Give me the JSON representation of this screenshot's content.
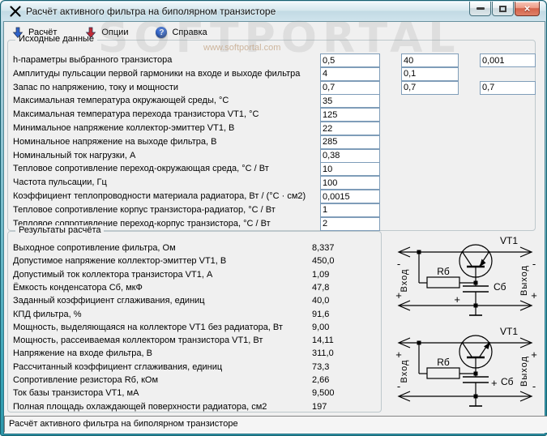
{
  "window": {
    "title": "Расчёт активного фильтра на биполярном транзисторе"
  },
  "toolbar": {
    "items": [
      {
        "label": "Расчёт",
        "icon": "calc-arrow-down-icon",
        "icon_color": "#2f62c9"
      },
      {
        "label": "Опции",
        "icon": "options-arrow-down-icon",
        "icon_color": "#c22a35"
      },
      {
        "label": "Справка",
        "icon": "help-icon",
        "icon_color": "#3b6fd6"
      }
    ]
  },
  "watermark": {
    "big_text": "SOFTPORTAL",
    "url_text": "www.softportal.com"
  },
  "inputs": {
    "legend": "Исходные данные",
    "rows": [
      {
        "label": "h-параметры выбранного транзистора",
        "values": [
          "0,5",
          "40",
          "0,001"
        ]
      },
      {
        "label": "Амплитуды пульсации первой гармоники на входе и выходе фильтра",
        "values": [
          "4",
          "0,1"
        ]
      },
      {
        "label": "Запас по напряжению, току и мощности",
        "values": [
          "0,7",
          "0,7",
          "0,7"
        ]
      },
      {
        "label": "Максимальная температура окружающей среды, °С",
        "values": [
          "35"
        ]
      },
      {
        "label": "Максимальная температура перехода транзистора VT1, °С",
        "values": [
          "125"
        ]
      },
      {
        "label": "Минимальное напряжение коллектор-эмиттер VT1, В",
        "values": [
          "22"
        ]
      },
      {
        "label": "Номинальное напряжение на выходе фильтра, В",
        "values": [
          "285"
        ]
      },
      {
        "label": "Номинальный ток нагрузки, А",
        "values": [
          "0,38"
        ]
      },
      {
        "label": "Тепловое сопротивление переход-окружающая среда, °С / Вт",
        "values": [
          "10"
        ]
      },
      {
        "label": "Частота пульсации, Гц",
        "values": [
          "100"
        ]
      },
      {
        "label": "Коэффициент теплопроводности материала радиатора, Вт / (°С · см2)",
        "values": [
          "0,0015"
        ]
      },
      {
        "label": "Тепловое сопротивление корпус транзистора-радиатор, °С / Вт",
        "values": [
          "1"
        ]
      },
      {
        "label": "Тепловое сопротивление переход-корпус транзистора, °С / Вт",
        "values": [
          "2"
        ]
      }
    ]
  },
  "results": {
    "legend": "Результаты расчёта",
    "rows": [
      {
        "label": "Выходное сопротивление фильтра, Ом",
        "value": "8,337"
      },
      {
        "label": "Допустимое напряжение коллектор-эмиттер VT1, В",
        "value": "450,0"
      },
      {
        "label": "Допустимый ток коллектора транзистора VT1, А",
        "value": "1,09"
      },
      {
        "label": "Ёмкость конденсатора Сб, мкФ",
        "value": "47,8"
      },
      {
        "label": "Заданный коэффициент сглаживания, единиц",
        "value": "40,0"
      },
      {
        "label": "КПД фильтра, %",
        "value": "91,6"
      },
      {
        "label": "Мощность, выделяющаяся на коллекторе VT1 без радиатора, Вт",
        "value": "9,00"
      },
      {
        "label": "Мощность, рассеиваемая коллектором транзистора VT1, Вт",
        "value": "14,11"
      },
      {
        "label": "Напряжение на входе фильтра, В",
        "value": "311,0"
      },
      {
        "label": "Рассчитанный коэффициент сглаживания, единиц",
        "value": "73,3"
      },
      {
        "label": "Сопротивление резистора Rб, кОм",
        "value": "2,66"
      },
      {
        "label": "Ток базы транзистора VT1, мА",
        "value": "9,500"
      },
      {
        "label": "Полная площадь охлаждающей поверхности радиатора, см2",
        "value": "197"
      }
    ]
  },
  "circuits": [
    {
      "type": "pnp",
      "transistor_label": "VT1",
      "resistor_label": "Rб",
      "capacitor_label": "Сб",
      "input_label": "Вход",
      "output_label": "Выход",
      "in_top": "-",
      "in_bottom": "+",
      "out_top": "-",
      "out_bottom": "+",
      "cap_sign": "+"
    },
    {
      "type": "npn",
      "transistor_label": "VT1",
      "resistor_label": "Rб",
      "capacitor_label": "Сб",
      "input_label": "Вход",
      "output_label": "Выход",
      "in_top": "+",
      "in_bottom": "-",
      "out_top": "+",
      "out_bottom": "-",
      "cap_sign": "+"
    }
  ],
  "statusbar": {
    "text": "Расчёт активного фильтра на биполярном транзисторе"
  },
  "theme": {
    "frame_teal": "#3aa5b8",
    "titlebar_blue": "#cfe3ec",
    "client_bg": "#f0f0f0",
    "field_border": "#7f9db9",
    "close_red": "#d4634a"
  }
}
